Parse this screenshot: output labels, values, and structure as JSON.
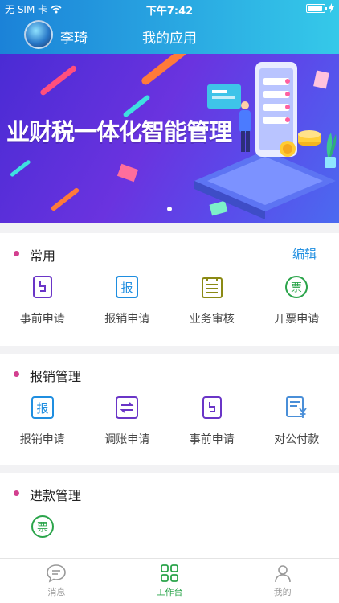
{
  "status_bar": {
    "carrier": "无 SIM 卡",
    "time": "下午7:42"
  },
  "header": {
    "username": "李琦",
    "title": "我的应用"
  },
  "banner": {
    "text": "业财税一体化智能管理"
  },
  "sections": [
    {
      "title": "常用",
      "action": "编辑",
      "items": [
        {
          "label": "事前申请",
          "icon": "document-icon"
        },
        {
          "label": "报销申请",
          "icon": "reimburse-icon"
        },
        {
          "label": "业务审核",
          "icon": "calendar-list-icon"
        },
        {
          "label": "开票申请",
          "icon": "invoice-icon"
        }
      ]
    },
    {
      "title": "报销管理",
      "items": [
        {
          "label": "报销申请",
          "icon": "reimburse-icon"
        },
        {
          "label": "调账申请",
          "icon": "transfer-icon"
        },
        {
          "label": "事前申请",
          "icon": "document-icon"
        },
        {
          "label": "对公付款",
          "icon": "payment-icon"
        }
      ]
    },
    {
      "title": "进款管理",
      "items": [
        {
          "label": "",
          "icon": "invoice-icon"
        }
      ]
    }
  ],
  "tabbar": {
    "tabs": [
      {
        "label": "消息",
        "icon": "message-icon"
      },
      {
        "label": "工作台",
        "icon": "grid-icon"
      },
      {
        "label": "我的",
        "icon": "person-icon"
      }
    ],
    "active_index": 1
  },
  "icon_glyphs": {
    "reimburse": "报",
    "invoice": "票"
  },
  "colors": {
    "accent_blue": "#1f8ee0",
    "section_dot": "#d33f8f",
    "active_tab": "#2aa44a",
    "purple_icon": "#6a35c7",
    "olive_icon": "#8b8a14",
    "green_icon": "#2aa44a"
  }
}
